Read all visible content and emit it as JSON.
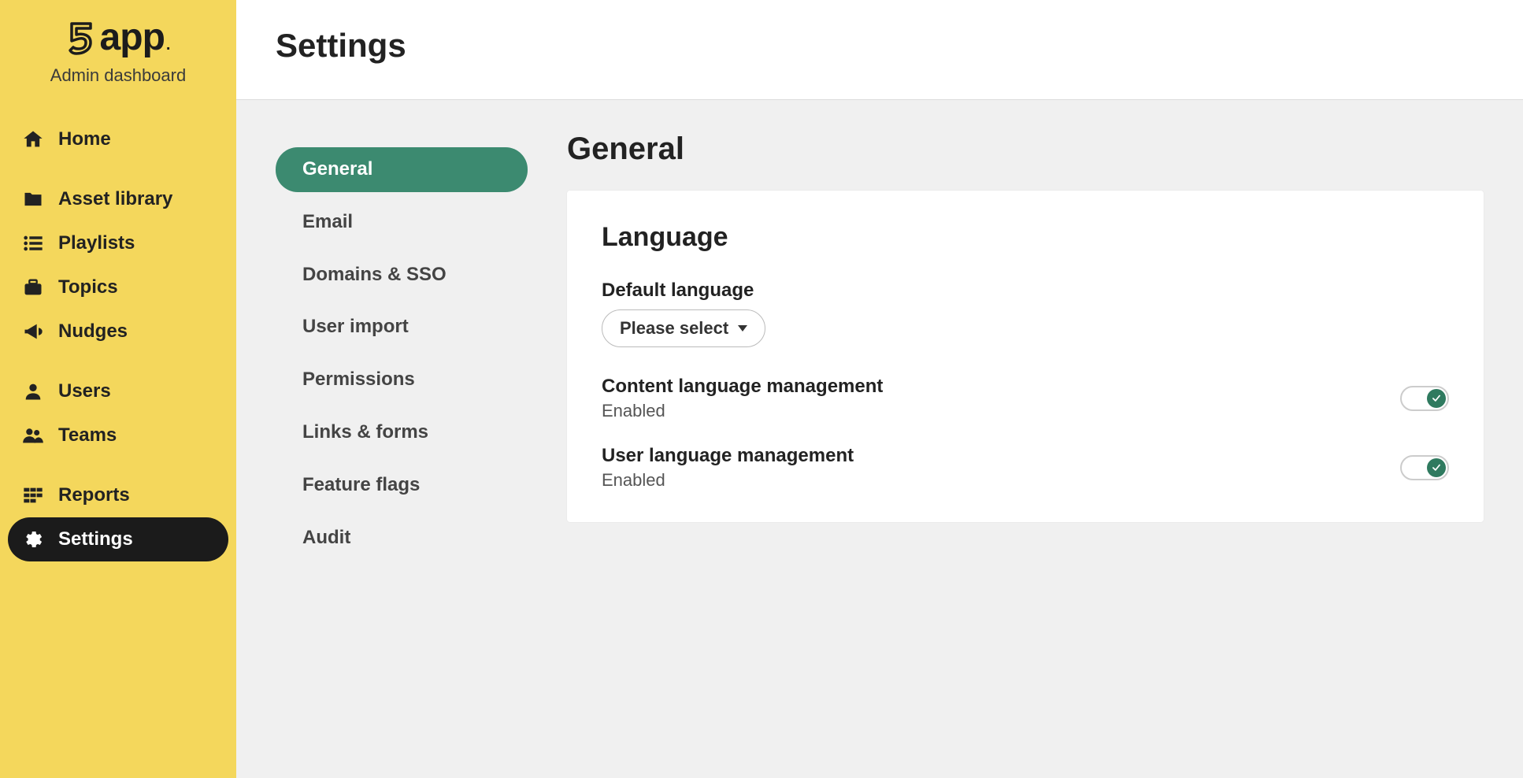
{
  "brand": {
    "logo_text": "5app",
    "subtitle": "Admin dashboard"
  },
  "sidebar": {
    "items": [
      {
        "label": "Home"
      },
      {
        "label": "Asset library"
      },
      {
        "label": "Playlists"
      },
      {
        "label": "Topics"
      },
      {
        "label": "Nudges"
      },
      {
        "label": "Users"
      },
      {
        "label": "Teams"
      },
      {
        "label": "Reports"
      },
      {
        "label": "Settings"
      }
    ]
  },
  "header": {
    "title": "Settings"
  },
  "subnav": {
    "items": [
      {
        "label": "General"
      },
      {
        "label": "Email"
      },
      {
        "label": "Domains & SSO"
      },
      {
        "label": "User import"
      },
      {
        "label": "Permissions"
      },
      {
        "label": "Links & forms"
      },
      {
        "label": "Feature flags"
      },
      {
        "label": "Audit"
      }
    ]
  },
  "panel": {
    "section_title": "General",
    "card_title": "Language",
    "default_language": {
      "label": "Default language",
      "value": "Please select"
    },
    "content_lang": {
      "label": "Content language management",
      "state": "Enabled",
      "on": true
    },
    "user_lang": {
      "label": "User language management",
      "state": "Enabled",
      "on": true
    }
  }
}
